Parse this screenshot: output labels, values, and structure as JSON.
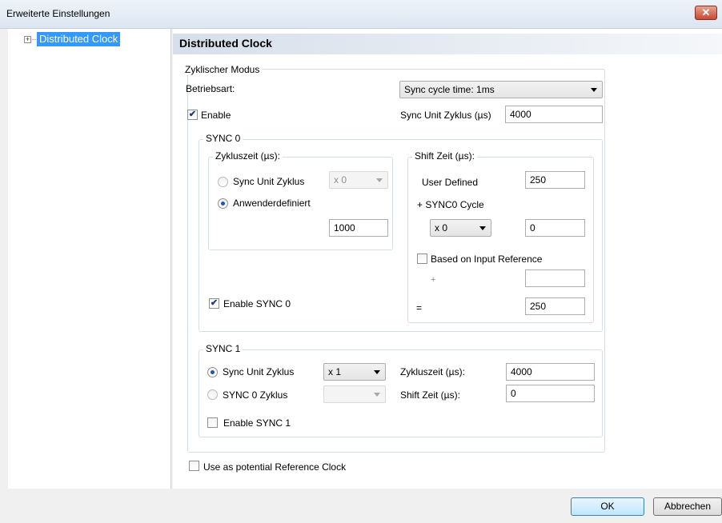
{
  "window": {
    "title": "Erweiterte Einstellungen",
    "close_glyph": "✕"
  },
  "tree": {
    "expander": "+",
    "item": "Distributed Clock"
  },
  "panel": {
    "title": "Distributed Clock"
  },
  "cyclic": {
    "legend": "Zyklischer Modus",
    "mode_label": "Betriebsart:",
    "mode_value": "Sync cycle time: 1ms",
    "enable_label": "Enable",
    "enable_checked": true,
    "sync_unit_label": "Sync Unit Zyklus (µs)",
    "sync_unit_value": "4000"
  },
  "sync0": {
    "legend": "SYNC 0",
    "cycle_legend": "Zykluszeit (µs):",
    "opt_sync_unit": "Sync Unit Zyklus",
    "opt_sync_unit_factor": "x 0",
    "opt_user": "Anwenderdefiniert",
    "selected": "user",
    "user_value": "1000",
    "shift_legend": "Shift Zeit (µs):",
    "user_defined_label": "User Defined",
    "user_defined_value": "250",
    "plus_sync0_label": "+ SYNC0 Cycle",
    "plus_factor": "x 0",
    "plus_value": "0",
    "input_ref_label": "Based on Input Reference",
    "input_ref_checked": false,
    "plus_sign": "+",
    "input_ref_value": "",
    "equals_sign": "=",
    "result_value": "250",
    "enable_label": "Enable SYNC 0",
    "enable_checked": true
  },
  "sync1": {
    "legend": "SYNC 1",
    "opt_sync_unit": "Sync Unit Zyklus",
    "opt_sync_unit_factor": "x 1",
    "opt_sync0": "SYNC 0 Zyklus",
    "opt_sync0_factor": "",
    "selected": "sync_unit",
    "cycle_label": "Zykluszeit (µs):",
    "cycle_value": "4000",
    "shift_label": "Shift Zeit (µs):",
    "shift_value": "0",
    "enable_label": "Enable SYNC 1",
    "enable_checked": false
  },
  "reference": {
    "label": "Use as potential Reference Clock",
    "checked": false
  },
  "buttons": {
    "ok": "OK",
    "cancel": "Abbrechen"
  },
  "check_glyph": "✔"
}
